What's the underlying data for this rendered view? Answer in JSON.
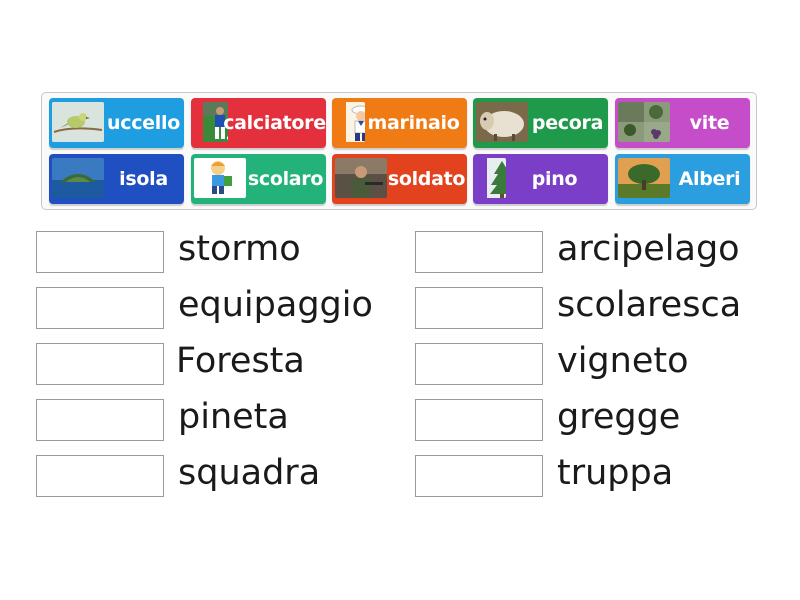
{
  "tiles": [
    {
      "label": "uccello",
      "color": "#1e9ee0",
      "image": "bird-image"
    },
    {
      "label": "calciatore",
      "color": "#e4303c",
      "image": "soccer-player-image"
    },
    {
      "label": "marinaio",
      "color": "#f07a14",
      "image": "sailor-image"
    },
    {
      "label": "pecora",
      "color": "#1e9a4a",
      "image": "sheep-image"
    },
    {
      "label": "vite",
      "color": "#c54dc9",
      "image": "grapevine-image"
    },
    {
      "label": "isola",
      "color": "#1f4fc0",
      "image": "island-image"
    },
    {
      "label": "scolaro",
      "color": "#23b27a",
      "image": "schoolboy-image"
    },
    {
      "label": "soldato",
      "color": "#e2431e",
      "image": "soldier-image"
    },
    {
      "label": "pino",
      "color": "#7a3fc6",
      "image": "pine-tree-image"
    },
    {
      "label": "Alberi",
      "color": "#2b9ee0",
      "image": "tree-image"
    }
  ],
  "targets": [
    {
      "word": "stormo"
    },
    {
      "word": "arcipelago"
    },
    {
      "word": "equipaggio"
    },
    {
      "word": "scolaresca"
    },
    {
      "word": "Foresta"
    },
    {
      "word": "vigneto"
    },
    {
      "word": "pineta"
    },
    {
      "word": "gregge"
    },
    {
      "word": "squadra"
    },
    {
      "word": "truppa"
    }
  ]
}
